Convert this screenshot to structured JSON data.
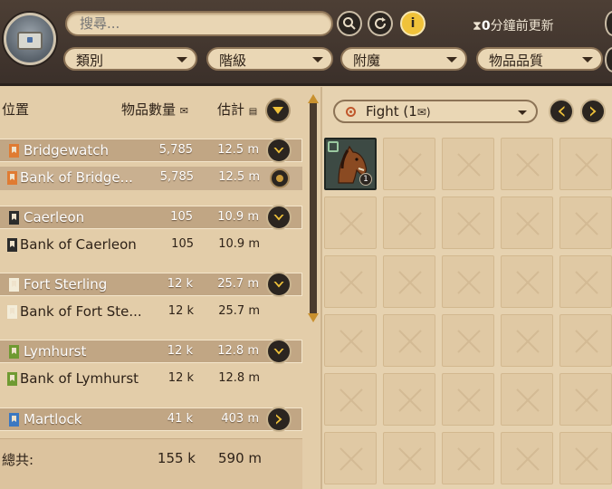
{
  "header": {
    "search_placeholder": "搜尋...",
    "timer_value": "0",
    "timer_unit": "分鐘前更新",
    "filters": [
      {
        "label": "類別"
      },
      {
        "label": "階級"
      },
      {
        "label": "附魔"
      },
      {
        "label": "物品品質"
      }
    ]
  },
  "columns": {
    "location": "位置",
    "count": "物品數量",
    "estimate": "估計"
  },
  "locations": [
    {
      "type": "city",
      "name": "Bridgewatch",
      "count": "5,785",
      "estimate": "12.5 m",
      "flag_color": "#e07b32",
      "expand": "down"
    },
    {
      "type": "bank",
      "name": "Bank of Bridge...",
      "count": "5,785",
      "estimate": "12.5 m",
      "flag_color": "#e07b32",
      "highlight": true
    },
    {
      "type": "city",
      "name": "Caerleon",
      "count": "105",
      "estimate": "10.9 m",
      "flag_color": "#2c2c2c",
      "expand": "down"
    },
    {
      "type": "bank",
      "name": "Bank of Caerleon",
      "count": "105",
      "estimate": "10.9 m",
      "flag_color": "#2c2c2c"
    },
    {
      "type": "city",
      "name": "Fort Sterling",
      "count": "12 k",
      "estimate": "25.7 m",
      "flag_color": "#f3ecd8",
      "expand": "down"
    },
    {
      "type": "bank",
      "name": "Bank of Fort Ste...",
      "count": "12 k",
      "estimate": "25.7 m",
      "flag_color": "#f3ecd8"
    },
    {
      "type": "city",
      "name": "Lymhurst",
      "count": "12 k",
      "estimate": "12.8 m",
      "flag_color": "#6f9a32",
      "expand": "down"
    },
    {
      "type": "bank",
      "name": "Bank of Lymhurst",
      "count": "12 k",
      "estimate": "12.8 m",
      "flag_color": "#6f9a32"
    },
    {
      "type": "city",
      "name": "Martlock",
      "count": "41 k",
      "estimate": "403 m",
      "flag_color": "#3a78c2",
      "expand": "right"
    }
  ],
  "total": {
    "label": "總共:",
    "count": "155 k",
    "estimate": "590 m"
  },
  "tab_selector": {
    "label": "Fight (1",
    "icon": "checkmark-icon"
  },
  "inventory": {
    "items": [
      {
        "name": "horse",
        "quantity": "1"
      }
    ]
  },
  "icons": {
    "search": "search-icon",
    "refresh": "refresh-icon",
    "info": "info-icon",
    "timer": "hourglass-icon"
  }
}
